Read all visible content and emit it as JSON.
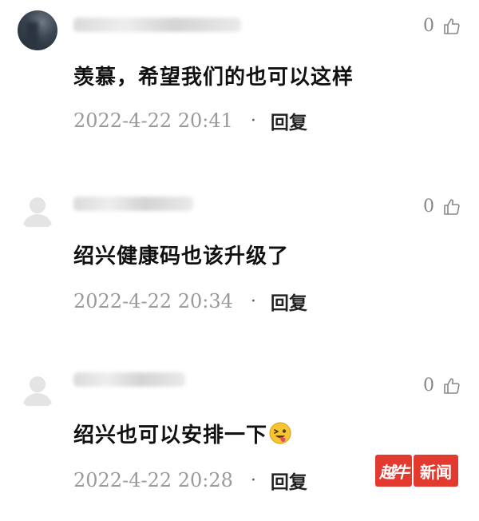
{
  "comments": [
    {
      "avatar": "photo-avatar",
      "likes": "0",
      "text": "羡慕，希望我们的也可以这样",
      "timestamp": "2022-4-22  20:41",
      "separator": "·",
      "reply_label": "回复"
    },
    {
      "avatar": "default-avatar",
      "likes": "0",
      "text": "绍兴健康码也该升级了",
      "timestamp": "2022-4-22  20:34",
      "separator": "·",
      "reply_label": "回复"
    },
    {
      "avatar": "default-avatar",
      "likes": "0",
      "text": "绍兴也可以安排一下",
      "emoji": "winking-tongue-emoji",
      "timestamp": "2022-4-22  20:28",
      "separator": "·",
      "reply_label": "回复"
    }
  ],
  "icons": {
    "like": "thumbs-up-icon",
    "avatar_default": "user-silhouette-icon"
  },
  "watermark": {
    "logo": "越牛",
    "text": "新闻",
    "color": "#e23a2e"
  }
}
